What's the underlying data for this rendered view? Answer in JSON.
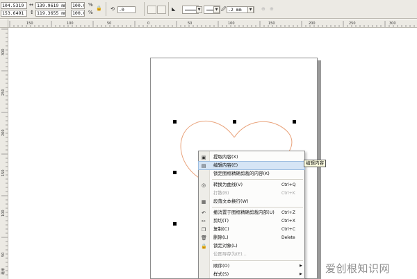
{
  "propbar": {
    "pos_x": "104.5319 mm",
    "pos_y": "153.6491 mm",
    "width": "139.9619 mm",
    "height": "119.3655 mm",
    "scale_x": "100.0",
    "scale_y": "100.0",
    "percent": "%",
    "rotation": ".0",
    "outline_width": ".2 mm"
  },
  "rulers": {
    "h_labels": [
      "150",
      "100",
      "50",
      "0",
      "50",
      "100",
      "150",
      "200",
      "250",
      "300"
    ],
    "v_labels": [
      "300",
      "250",
      "200",
      "150",
      "100",
      "50"
    ],
    "unit": "毫米"
  },
  "context_menu": {
    "items": [
      {
        "label": "提取内容(X)",
        "shortcut": "",
        "icon": "extract-icon"
      },
      {
        "label": "编辑内容(E)",
        "shortcut": "",
        "icon": "edit-contents-icon"
      },
      {
        "label": "锁定图框精确剪裁的内容(K)",
        "shortcut": "",
        "icon": ""
      },
      {
        "label": "转换为曲线(V)",
        "shortcut": "Ctrl+Q",
        "icon": "convert-icon"
      },
      {
        "label": "打散(B)",
        "shortcut": "Ctrl+K",
        "icon": ""
      },
      {
        "label": "段落文本换行(W)",
        "shortcut": "",
        "icon": "wrap-icon"
      },
      {
        "label": "撤消置于图框精确剪裁内部(U)",
        "shortcut": "Ctrl+Z",
        "icon": "undo-icon"
      },
      {
        "label": "剪切(T)",
        "shortcut": "Ctrl+X",
        "icon": "scissors-icon"
      },
      {
        "label": "复制(C)",
        "shortcut": "Ctrl+C",
        "icon": "copy-icon"
      },
      {
        "label": "删除(L)",
        "shortcut": "Delete",
        "icon": "trash-icon"
      },
      {
        "label": "锁定对象(L)",
        "shortcut": "",
        "icon": "lock-icon"
      },
      {
        "label": "位图导存为(E)...",
        "shortcut": "",
        "icon": ""
      },
      {
        "label": "顺序(O)",
        "shortcut": "",
        "icon": ""
      },
      {
        "label": "样式(S)",
        "shortcut": "",
        "icon": ""
      }
    ]
  },
  "tooltip": {
    "text": "编辑内容"
  },
  "watermark": {
    "text": "爱创根知识网"
  },
  "colors": {
    "heart_outline": "#e9a27a",
    "highlight": "#d6e5f5"
  }
}
